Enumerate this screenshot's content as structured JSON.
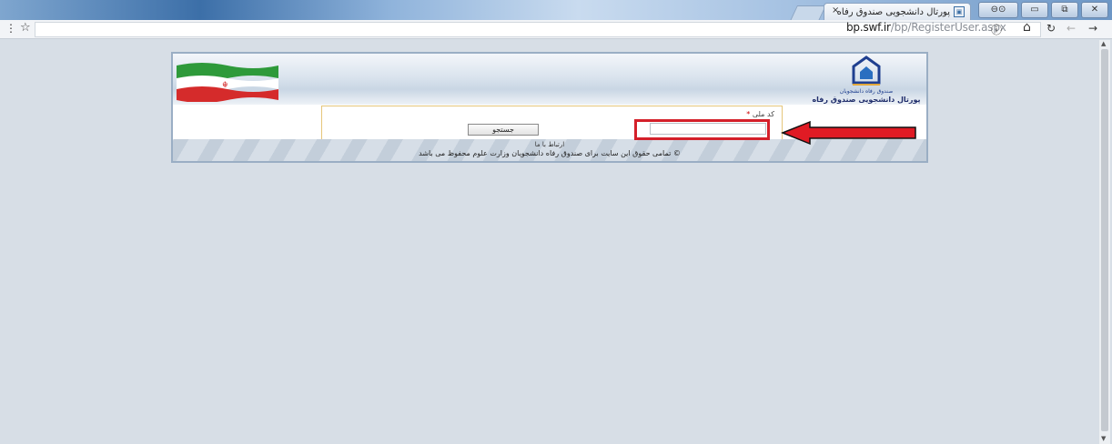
{
  "browser": {
    "tab_title": "پورتال دانشجویی صندوق رفاه",
    "tab_close": "×",
    "url_host": "bp.swf.ir",
    "url_path": "/bp/RegisterUser.aspx",
    "menu_icon": "⋮",
    "star_icon": "☆",
    "info_icon": "ⓘ",
    "home_icon": "⌂",
    "reload_icon": "↻",
    "back_icon": "←",
    "forward_icon": "→",
    "window_buttons": [
      "⊖⊙",
      "▭",
      "⧉",
      "✕"
    ]
  },
  "header": {
    "portal_title": "پورتال دانشجویی صندوق رفاه",
    "emblem_caption": "صندوق رفاه دانشجویان"
  },
  "form": {
    "national_code_label": "کد ملی",
    "required_mark": "*",
    "national_code_value": "",
    "search_button": "جستجو"
  },
  "footer": {
    "contact": "ارتباط با ما",
    "copyright": "© تمامی حقوق این سایت برای صندوق رفاه دانشجویان وزارت علوم محفوظ می باشد"
  },
  "colors": {
    "page_background": "#d7dee6",
    "highlight_red": "#d4202a",
    "form_border": "#e6c67a"
  }
}
